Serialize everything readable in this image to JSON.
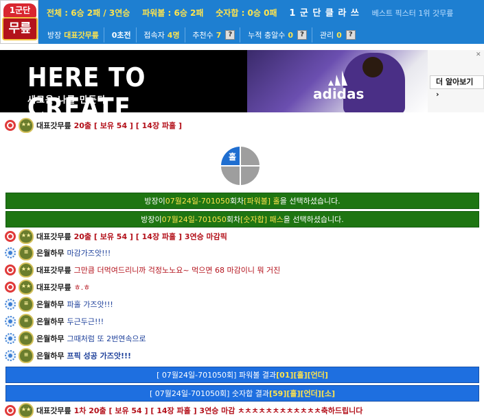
{
  "header": {
    "logo_top": "1군단",
    "logo_main": "무릎",
    "stats": {
      "total": "전체 : 6승 2패 / 3연승",
      "powerball": "파워볼 : 6승 2패",
      "sum": "숫자합 : 0승 0패",
      "grade": "1 군 단 클 라 쓰",
      "best": "베스트 픽스터 1위 갓무릎"
    },
    "info": {
      "host_label": "방장",
      "host_value": "대표갓무릎",
      "zeros": "0초전",
      "viewers_label": "접속자",
      "viewers_value": "4명",
      "recommend_label": "추천수",
      "recommend_value": "7",
      "charge_label": "누적 충알수",
      "charge_value": "0",
      "admin_label": "관리",
      "admin_value": "0",
      "help": "?"
    }
  },
  "ad": {
    "headline": "HERE TO CREATE",
    "subline": "새로운 나를 만든다",
    "brand": "adidas",
    "cta": "더 알아보기 ›",
    "close": "✕"
  },
  "picker": {
    "selected": "홀"
  },
  "chat": [
    {
      "kind": "red",
      "nick": "대표갓무릎",
      "msg": "20출 [ 보유 54 ] [ 14장 파홀 ]",
      "style": "red"
    },
    {
      "kind": "red",
      "nick": "대표갓무릎",
      "msg": "20출 [ 보유 54 ] [ 14장 파홀 ] 3연승 마감픽",
      "style": "red"
    },
    {
      "kind": "blue",
      "nick": "은월하무",
      "msg": "마감가즈앗!!!",
      "style": "blue"
    },
    {
      "kind": "red",
      "nick": "대표갓무릎",
      "msg": "그만큼 더먹여드리니까 걱정노노요~ 먹으면 68 마감이니 뭐 거진",
      "style": "red"
    },
    {
      "kind": "red",
      "nick": "대표갓무릎",
      "msg": "ㅎ.ㅎ",
      "style": "red"
    },
    {
      "kind": "blue",
      "nick": "은월하무",
      "msg": "파홀 가즈앗!!!",
      "style": "blue"
    },
    {
      "kind": "blue",
      "nick": "은월하무",
      "msg": "두근두근!!!",
      "style": "blue"
    },
    {
      "kind": "blue",
      "nick": "은월하무",
      "msg": "그때처럼 또 2번연속으로",
      "style": "blue"
    },
    {
      "kind": "blue",
      "nick": "은월하무",
      "msg": "프픽 성공 가즈앗!!!",
      "style": "blue"
    },
    {
      "kind": "red",
      "nick": "대표갓무릎",
      "msg": "1차 20출 [ 보유 54 ] [ 14장 파홀 ] 3연승 마감 ㅊㅊㅊㅊㅊㅊㅊㅊㅊㅊㅊㅊ축하드립니다",
      "style": "red"
    }
  ],
  "notices": [
    {
      "pre": "방장이 ",
      "round": "07월24일-701050",
      "mid": "회차 ",
      "pick": "[파워볼] 홀",
      "post": " 을 선택하셨습니다."
    },
    {
      "pre": "방장이 ",
      "round": "07월24일-701050",
      "mid": "회차 ",
      "pick": "[숫자합] 패스",
      "post": " 을 선택하셨습니다."
    }
  ],
  "results": [
    {
      "pre": "[ 07월24일-701050회] 파워볼 결과 ",
      "res": "[01][홀][언더]"
    },
    {
      "pre": "[ 07월24일-701050회] 숫자합 결과 ",
      "res": "[59][홀][언더][소]"
    }
  ],
  "colors": {
    "header_blue": "#1e7fd1",
    "notice_green": "#1e7512",
    "result_blue": "#1e6fe0",
    "highlight_yellow": "#ffe44d"
  }
}
